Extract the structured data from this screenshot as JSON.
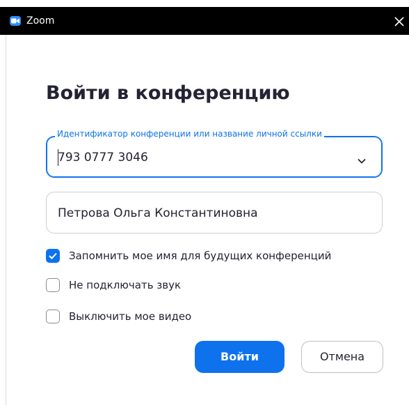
{
  "window": {
    "title": "Zoom",
    "icon": "zoom-camera-icon",
    "close_icon": "close-icon",
    "titlebar_color": "#000000"
  },
  "dialog": {
    "heading": "Войти в конференцию",
    "meeting_id": {
      "label": "Идентификатор конференции или название личной ссылки",
      "value": "793 0777 3046",
      "dropdown_icon": "chevron-down-icon"
    },
    "name": {
      "value": "Петрова Ольга Константиновна"
    },
    "options": [
      {
        "label": "Запомнить мое имя для будущих конференций",
        "checked": true
      },
      {
        "label": "Не подключать звук",
        "checked": false
      },
      {
        "label": "Выключить мое видео",
        "checked": false
      }
    ],
    "buttons": {
      "join_label": "Войти",
      "cancel_label": "Отмена"
    }
  },
  "colors": {
    "accent": "#0E72ED",
    "text": "#232333",
    "border": "#cfcfd6"
  }
}
